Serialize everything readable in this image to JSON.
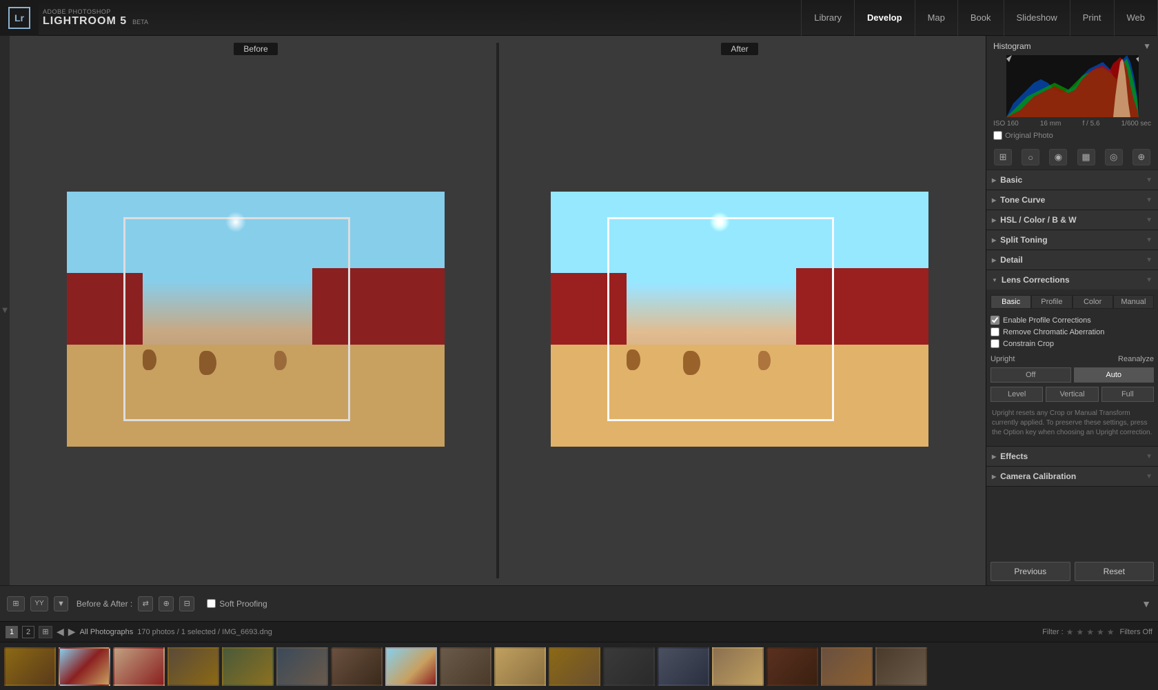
{
  "app": {
    "adobe_text": "ADOBE PHOTOSHOP",
    "lr_name": "LIGHTROOM 5",
    "beta_badge": "BETA",
    "logo_text": "Lr"
  },
  "nav": {
    "items": [
      "Library",
      "Develop",
      "Map",
      "Book",
      "Slideshow",
      "Print",
      "Web"
    ],
    "active": "Develop"
  },
  "view": {
    "before_label": "Before",
    "after_label": "After"
  },
  "histogram": {
    "title": "Histogram",
    "iso": "ISO 160",
    "lens": "16 mm",
    "aperture": "f / 5.6",
    "shutter": "1/600 sec",
    "original_photo": "Original Photo"
  },
  "tools": {
    "icons": [
      "⊞",
      "○",
      "◉",
      "▦",
      "◎",
      "⊕"
    ]
  },
  "panels": {
    "basic": "Basic",
    "tone_curve": "Tone Curve",
    "hsl": "HSL / Color / B & W",
    "split_toning": "Split Toning",
    "detail": "Detail",
    "lens_corrections": "Lens Corrections",
    "effects": "Effects",
    "camera_calibration": "Camera Calibration"
  },
  "lens_corrections": {
    "tabs": [
      "Basic",
      "Profile",
      "Color",
      "Manual"
    ],
    "active_tab": "Basic",
    "enable_profile": "Enable Profile Corrections",
    "remove_chromatic": "Remove Chromatic Aberration",
    "constrain_crop": "Constrain Crop",
    "upright_label": "Upright",
    "reanalyze_label": "Reanalyze",
    "off_label": "Off",
    "auto_label": "Auto",
    "level_label": "Level",
    "vertical_label": "Vertical",
    "full_label": "Full",
    "note": "Upright resets any Crop or Manual Transform currently applied. To preserve these settings, press the Option key when choosing an Upright correction."
  },
  "toolbar": {
    "before_after_label": "Before & After :",
    "soft_proofing": "Soft Proofing"
  },
  "bottom_buttons": {
    "previous": "Previous",
    "reset": "Reset"
  },
  "filmstrip": {
    "pages": [
      "1",
      "2"
    ],
    "collection": "All Photographs",
    "photo_count": "170 photos / 1 selected / IMG_6693.dng",
    "filter_label": "Filter :",
    "filters_off": "Filters Off"
  }
}
